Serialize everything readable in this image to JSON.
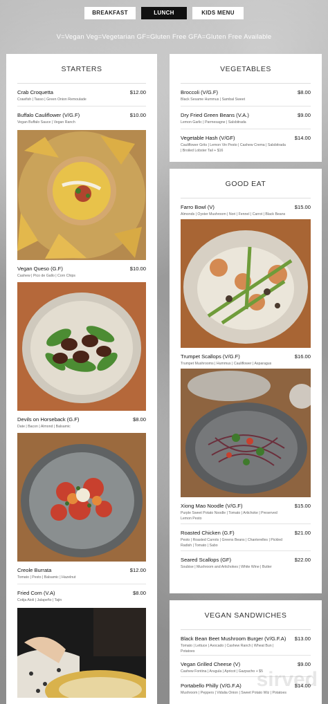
{
  "nav": {
    "tabs": [
      {
        "label": "BREAKFAST",
        "active": false
      },
      {
        "label": "LUNCH",
        "active": true
      },
      {
        "label": "KIDS MENU",
        "active": false
      }
    ]
  },
  "legend": "V=Vegan Veg=Vegetarian GF=Gluten Free GFA=Gluten Free Available",
  "starters": {
    "title": "STARTERS",
    "items": [
      {
        "name": "Crab Croquetta",
        "price": "$12.00",
        "desc": "Crawfish | Tasso | Green Onion Remoulade"
      },
      {
        "name": "Buffalo Cauliflower (V/G.F)",
        "price": "$10.00",
        "desc": "Vegan Buffalo Sauce | Vegan Ranch"
      },
      {
        "name": "Vegan Queso (G.F)",
        "price": "$10.00",
        "desc": "Cashew | Pico de Gallo | Corn Chips"
      },
      {
        "name": "Devils on Horseback (G.F)",
        "price": "$8.00",
        "desc": "Date | Bacon | Almond | Balsamic"
      },
      {
        "name": "Creole Burrata",
        "price": "$12.00",
        "desc": "Tomato | Pesto | Balsamic | Hazelnut"
      },
      {
        "name": "Fried Corn (V.A)",
        "price": "$8.00",
        "desc": "Cotija Aioli | Jalapeño | Tajin"
      }
    ]
  },
  "vegetables": {
    "title": "VEGETABLES",
    "items": [
      {
        "name": "Broccoli (V/G.F)",
        "price": "$8.00",
        "desc": "Black Sesame Hummus | Sambal Sweet"
      },
      {
        "name": "Dry Fried Green Beans (V.A.)",
        "price": "$9.00",
        "desc": "Lemon Garlic | Parmesagne | Salsbitrada"
      },
      {
        "name": "Vegetable Hash (V/GF)",
        "price": "$14.00",
        "desc": "Cauliflower Grits | Lemon Vin Pesto | Cashew Crema | Salsbitrada | Broiled Lobster Tail + $16"
      }
    ]
  },
  "good_eat": {
    "title": "GOOD EAT",
    "items": [
      {
        "name": "Farro Bowl (V)",
        "price": "$15.00",
        "desc": "Almonds | Oyster Mushroom | Nori | Fennel | Carrot | Black Beans"
      },
      {
        "name": "Trumpet Scallops (V/G.F)",
        "price": "$16.00",
        "desc": "Trumpet Mushrooms | Hummus | Cauliflower | Asparagus"
      },
      {
        "name": "Xiong Mao Noodle (V/G.F)",
        "price": "$15.00",
        "desc": "Purple Sweet Potato Noodle | Tomato | Artichoke | Preserved Lemon Pesto"
      },
      {
        "name": "Roasted Chicken (G.F)",
        "price": "$21.00",
        "desc": "Pesto | Roasted Carrots | Greens Beans | Chanterelles | Pickled Radish | Tomato | Sabo"
      },
      {
        "name": "Seared Scallops (GF)",
        "price": "$22.00",
        "desc": "Soubise | Mushroom and Artichokes | White Wine | Butter"
      }
    ]
  },
  "vegan_sandwiches": {
    "title": "VEGAN SANDWICHES",
    "items": [
      {
        "name": "Black Bean Beet Mushroom Burger (V/G.F.A)",
        "price": "$13.00",
        "desc": "Tomato | Lettuce | Avocado | Cashew Ranch | Wheat Bun | Potatoes"
      },
      {
        "name": "Vegan Grilled Cheese (V)",
        "price": "$9.00",
        "desc": "Cashew Fontina | Arugula | Apricot | Gazpacho + $5"
      },
      {
        "name": "Portabello Philly (V/G.F.A)",
        "price": "$14.00",
        "desc": "Mushroom | Peppers | Vidalia Onion | Sweet Potato Wiz | Potatoes"
      }
    ]
  },
  "watermark": "sirved"
}
